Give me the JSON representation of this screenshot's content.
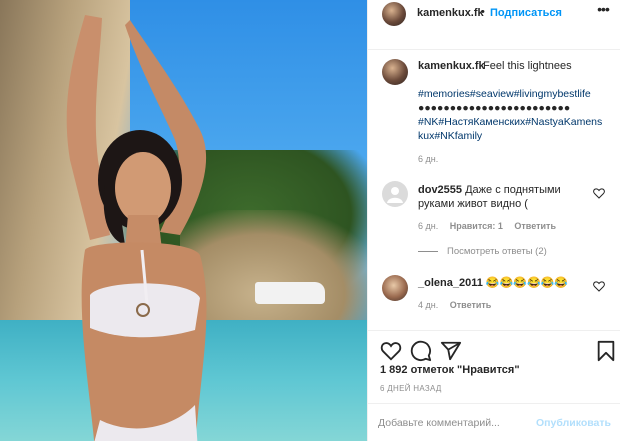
{
  "header": {
    "username": "kamenkux.fk",
    "separator": "•",
    "follow_label": "Подписаться",
    "more_icon": "more-horizontal-icon"
  },
  "caption": {
    "username": "kamenkux.fk",
    "text": "Feel this lightnees",
    "hashtags_line1": "#memories#seaview#livingmybestlife",
    "dots_line": "●●●●●●●●●●●●●●●●●●●●●●●●",
    "hashtags_line2": "#NK#НастяКаменских#NastyaKamens",
    "hashtags_line3": "kux#NKfamily",
    "time": "6 дн."
  },
  "comments": [
    {
      "username": "dov2555",
      "text": "Даже с поднятыми руками живот видно (",
      "time": "6 дн.",
      "likes": "Нравится: 1",
      "reply_label": "Ответить",
      "view_replies": "Посмотреть ответы (2)"
    },
    {
      "username": "_olena_2011",
      "text": "😂😂😂😂😂😂",
      "time": "4 дн.",
      "reply_label": "Ответить"
    }
  ],
  "actions": {
    "like_icon": "heart-icon",
    "comment_icon": "comment-icon",
    "share_icon": "share-icon",
    "save_icon": "bookmark-icon"
  },
  "likes_text": "1 892 отметок \"Нравится\"",
  "date_text": "6 ДНЕЙ НАЗАД",
  "add_comment": {
    "placeholder": "Добавьте комментарий...",
    "post_label": "Опубликовать"
  }
}
